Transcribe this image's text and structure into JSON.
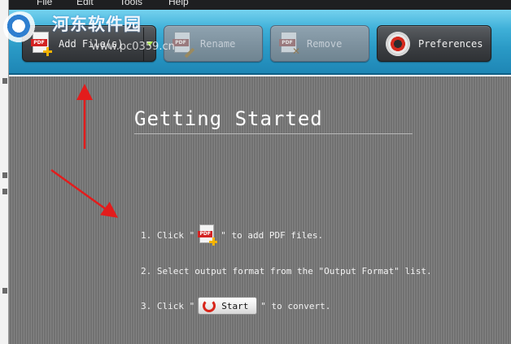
{
  "menu": {
    "items": [
      "File",
      "Edit",
      "Tools",
      "Help"
    ]
  },
  "toolbar": {
    "add_files_label": "Add File(s)",
    "rename_label": "Rename",
    "remove_label": "Remove",
    "preferences_label": "Preferences",
    "pdf_tag": "PDF"
  },
  "watermark": {
    "title": "河东软件园",
    "url": "www.pc0359.cn"
  },
  "getting_started": {
    "title": "Getting Started",
    "step1_prefix": "1. Click \"",
    "step1_suffix": "\" to add PDF files.",
    "step2_text": "2. Select output format from the \"Output Format\" list.",
    "step3_prefix": "3. Click \"",
    "step3_suffix": "\" to convert.",
    "start_label": "Start"
  },
  "colors": {
    "toolbar_top": "#75d2ef",
    "toolbar_bottom": "#1e86b5",
    "content_bg": "#7a7a7a",
    "arrow": "#e31c1c",
    "accent_red": "#d32222"
  }
}
